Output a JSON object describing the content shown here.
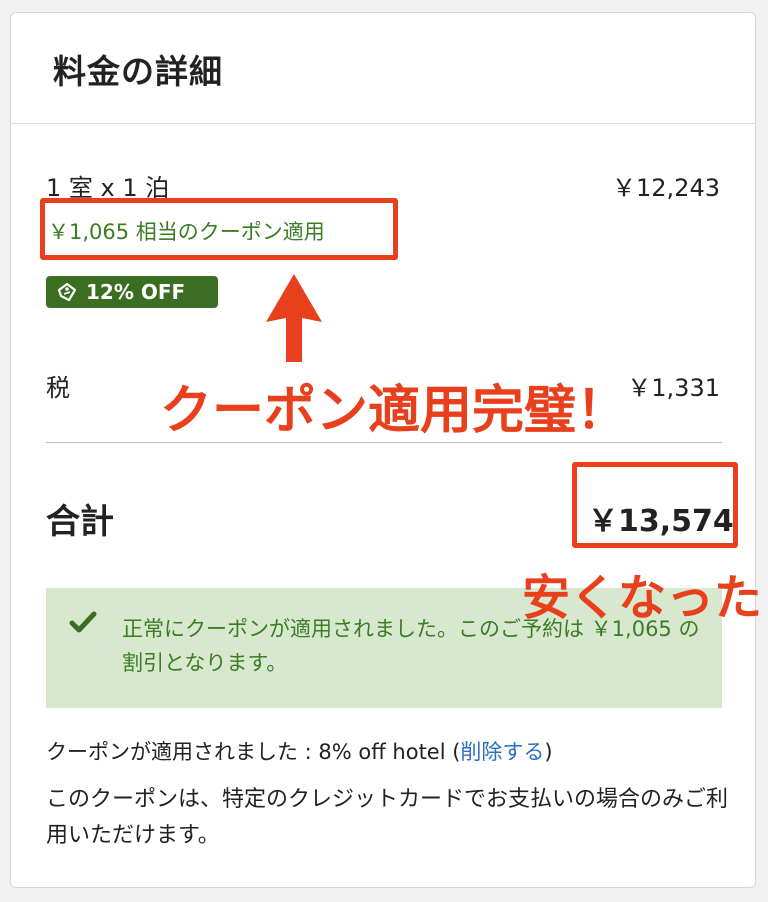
{
  "header": {
    "title": "料金の詳細"
  },
  "room": {
    "label": "1 室 x 1 泊",
    "price": "￥12,243"
  },
  "coupon_line": "￥1,065 相当のクーポン適用",
  "badge": {
    "label": "12% OFF",
    "icon": "coupon-tag-icon"
  },
  "tax": {
    "label": "税",
    "price": "￥1,331"
  },
  "total": {
    "label": "合計",
    "price": "￥13,574"
  },
  "success": {
    "icon": "checkmark-icon",
    "message": "正常にクーポンが適用されました。このご予約は ￥1,065 の割引となります。"
  },
  "applied": {
    "prefix": "クーポンが適用されました : 8% off hotel (",
    "remove_label": "削除する",
    "suffix": ")"
  },
  "note": "このクーポンは、特定のクレジットカードでお支払いの場合のみご利用いただけます。",
  "annotations": {
    "coupon_perfect": "クーポン適用完璧！",
    "cheaper": "安くなった"
  },
  "colors": {
    "accent_green": "#3b7d23",
    "badge_green": "#3b6e23",
    "success_bg": "#d7e8cf",
    "link_blue": "#2a6fc4",
    "annotation_red": "#e8401c"
  }
}
